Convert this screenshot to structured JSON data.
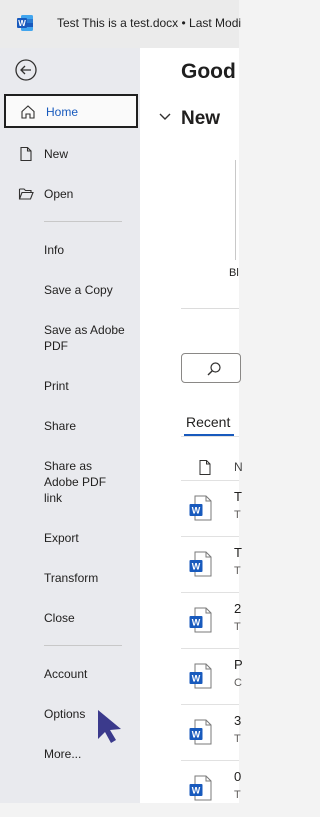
{
  "titlebar": {
    "title": "Test This is a test.docx • Last Modi"
  },
  "sidebar": {
    "home": "Home",
    "new": "New",
    "open": "Open",
    "info": "Info",
    "save_copy": "Save a Copy",
    "save_pdf": "Save as Adobe PDF",
    "print": "Print",
    "share": "Share",
    "share_pdf": "Share as Adobe PDF link",
    "export": "Export",
    "transform": "Transform",
    "close": "Close",
    "account": "Account",
    "options": "Options",
    "more": "More..."
  },
  "main": {
    "greeting": "Good",
    "new_heading": "New",
    "template_label": "Bl",
    "recent_tab": "Recent",
    "column_name": "N",
    "files": [
      {
        "name": "T",
        "sub": "T"
      },
      {
        "name": "T",
        "sub": "T"
      },
      {
        "name": "2",
        "sub": "T"
      },
      {
        "name": "P",
        "sub": "C"
      },
      {
        "name": "3",
        "sub": "T"
      },
      {
        "name": "0",
        "sub": "T"
      }
    ]
  },
  "colors": {
    "accent": "#185abd",
    "sidebar_bg": "#e9eaee",
    "cursor": "#3b3a8c"
  }
}
